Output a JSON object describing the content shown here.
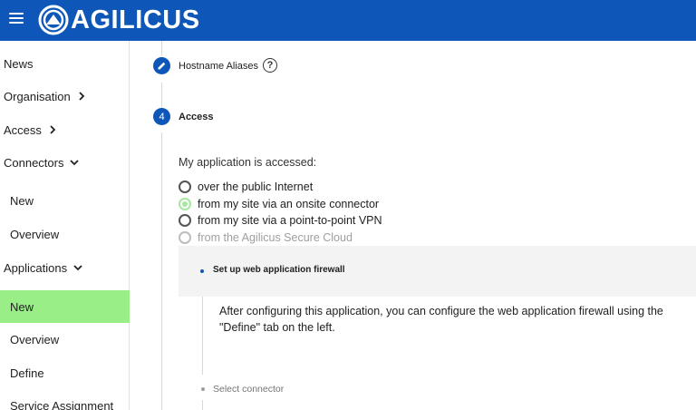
{
  "app": {
    "brand": "AGILICUS",
    "brand_color": "#0e57b8",
    "active_color": "#99ee88"
  },
  "sidebar": {
    "items": [
      {
        "label": "News"
      },
      {
        "label": "Organisation"
      },
      {
        "label": "Access"
      },
      {
        "label": "Connectors"
      },
      {
        "label": "New"
      },
      {
        "label": "Overview"
      },
      {
        "label": "Applications"
      },
      {
        "label": "New"
      },
      {
        "label": "Overview"
      },
      {
        "label": "Define"
      },
      {
        "label": "Service Assignment"
      }
    ]
  },
  "steps": [
    {
      "label": "Hostname Aliases",
      "icon": "pencil-icon"
    },
    {
      "number": "4",
      "label": "Access"
    }
  ],
  "access": {
    "question": "My application is accessed:",
    "options": [
      {
        "label": "over the public Internet",
        "state": "unchecked"
      },
      {
        "label": "from my site via an onsite connector",
        "state": "checked"
      },
      {
        "label": "from my site via a point-to-point VPN",
        "state": "unchecked"
      },
      {
        "label": "from the Agilicus Secure Cloud",
        "state": "disabled"
      }
    ]
  },
  "substeps": {
    "firewall": {
      "title": "Set up web application firewall",
      "text": "After configuring this application, you can configure the web application firewall using the \"Define\" tab on the left."
    },
    "connector": {
      "title": "Select connector"
    }
  }
}
